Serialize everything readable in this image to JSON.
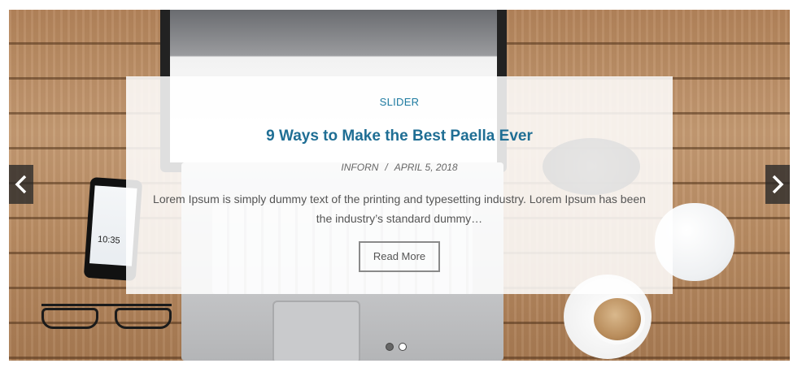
{
  "slide": {
    "category": "SLIDER",
    "title": "9 Ways to Make the Best Paella Ever",
    "author": "INFORN",
    "date": "APRIL 5, 2018",
    "separator": "/",
    "excerpt": "Lorem Ipsum is simply dummy text of the printing and typesetting industry. Lorem Ipsum has been the industry’s standard dummy…",
    "read_more_label": "Read More"
  },
  "phone": {
    "time": "10:35"
  },
  "navigation": {
    "prev_icon": "chevron-left-icon",
    "next_icon": "chevron-right-icon",
    "dots_count": 2,
    "active_dot": 1
  },
  "colors": {
    "title": "#1f6e94",
    "category": "#1d7aa0",
    "arrow_bg": "#282828"
  }
}
